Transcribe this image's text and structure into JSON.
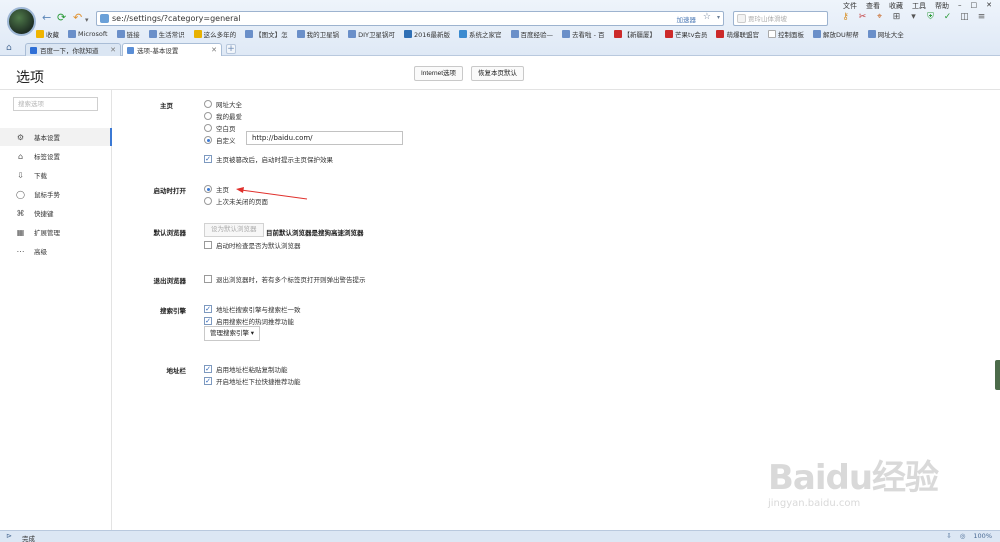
{
  "window": {
    "menu": [
      "文件",
      "查看",
      "收藏",
      "工具",
      "帮助"
    ],
    "address": "se://settings/?category=general",
    "speed_label": "加速器",
    "search_placeholder": "贾玲山体滑坡"
  },
  "bookmarks": [
    {
      "label": "收藏",
      "color": "#f0b400"
    },
    {
      "label": "Microsoft",
      "color": "#6a8fc9"
    },
    {
      "label": "链接",
      "color": "#6a8fc9"
    },
    {
      "label": "生活常识",
      "color": "#6a8fc9"
    },
    {
      "label": "这么多年的",
      "color": "#e8b100"
    },
    {
      "label": "【图文】怎",
      "color": "#6a8fc9"
    },
    {
      "label": "我的卫星锅",
      "color": "#6a8fc9"
    },
    {
      "label": "DIY卫星锅可",
      "color": "#6a8fc9"
    },
    {
      "label": "2016最新版",
      "color": "#2f6fb5"
    },
    {
      "label": "系统之家官",
      "color": "#3a8ad0"
    },
    {
      "label": "百度经验—",
      "color": "#6a8fc9"
    },
    {
      "label": "去看啦 - 百",
      "color": "#6a8fc9"
    },
    {
      "label": "【新疆厦】",
      "color": "#cc2a2a"
    },
    {
      "label": "芒果tv会员",
      "color": "#cc2a2a"
    },
    {
      "label": "萌爆联盟官",
      "color": "#cc2a2a"
    },
    {
      "label": "控制面板",
      "color": "#ffffff"
    },
    {
      "label": "解放DU帮帮",
      "color": "#6a8fc9"
    },
    {
      "label": "网址大全",
      "color": "#6a8fc9"
    }
  ],
  "tabs": [
    {
      "label": "百度一下，你就知道",
      "active": false
    },
    {
      "label": "选项-基本设置",
      "active": true
    }
  ],
  "page": {
    "title": "选项",
    "internet_options": "Internet选项",
    "restore_default": "恢复本页默认"
  },
  "sidebar": {
    "search_placeholder": "搜索选项",
    "items": [
      {
        "label": "基本设置",
        "icon": "gear-icon",
        "glyph": "⚙",
        "active": true
      },
      {
        "label": "标签设置",
        "icon": "tab-icon",
        "glyph": "⌂"
      },
      {
        "label": "下载",
        "icon": "download-icon",
        "glyph": "⇩"
      },
      {
        "label": "鼠标手势",
        "icon": "mouse-icon",
        "glyph": "◯"
      },
      {
        "label": "快捷键",
        "icon": "keyboard-icon",
        "glyph": "⌘"
      },
      {
        "label": "扩展管理",
        "icon": "extension-icon",
        "glyph": "▦"
      },
      {
        "label": "高级",
        "icon": "more-icon",
        "glyph": "⋯"
      }
    ]
  },
  "homepage": {
    "label": "主页",
    "options": [
      "网址大全",
      "我的最爱",
      "空白页",
      "自定义"
    ],
    "selected": "自定义",
    "custom_url": "http://baidu.com/",
    "protect_label": "主页被篡改后，启动时提示主页保护效果",
    "protect_checked": true
  },
  "startup": {
    "label": "启动时打开",
    "options": [
      "主页",
      "上次未关闭的页面"
    ],
    "selected": "主页"
  },
  "default_browser": {
    "label": "默认浏览器",
    "button": "设为默认浏览器",
    "status": "目前默认浏览器是搜狗高速浏览器",
    "check_label": "启动时检查是否为默认浏览器",
    "check_checked": false
  },
  "exit": {
    "label": "退出浏览器",
    "check_label": "退出浏览器时，若有多个标签页打开则弹出警告提示",
    "check_checked": false
  },
  "search_engine": {
    "label": "搜索引擎",
    "opt1": "地址栏搜索引擎与搜索栏一致",
    "opt2": "启用搜索栏的热词推荐功能",
    "manage": "管理搜索引擎 ▾"
  },
  "address_bar": {
    "label": "地址栏",
    "opt1": "启用地址栏粘贴复制功能",
    "opt2": "开启地址栏下拉快捷推荐功能"
  },
  "status": {
    "text": "完成",
    "zoom": "100%"
  },
  "watermark": {
    "logo": "Baidu经验",
    "url": "jingyan.baidu.com"
  },
  "colors": {
    "accent": "#3b79d4",
    "arrow": "#e0302c"
  }
}
